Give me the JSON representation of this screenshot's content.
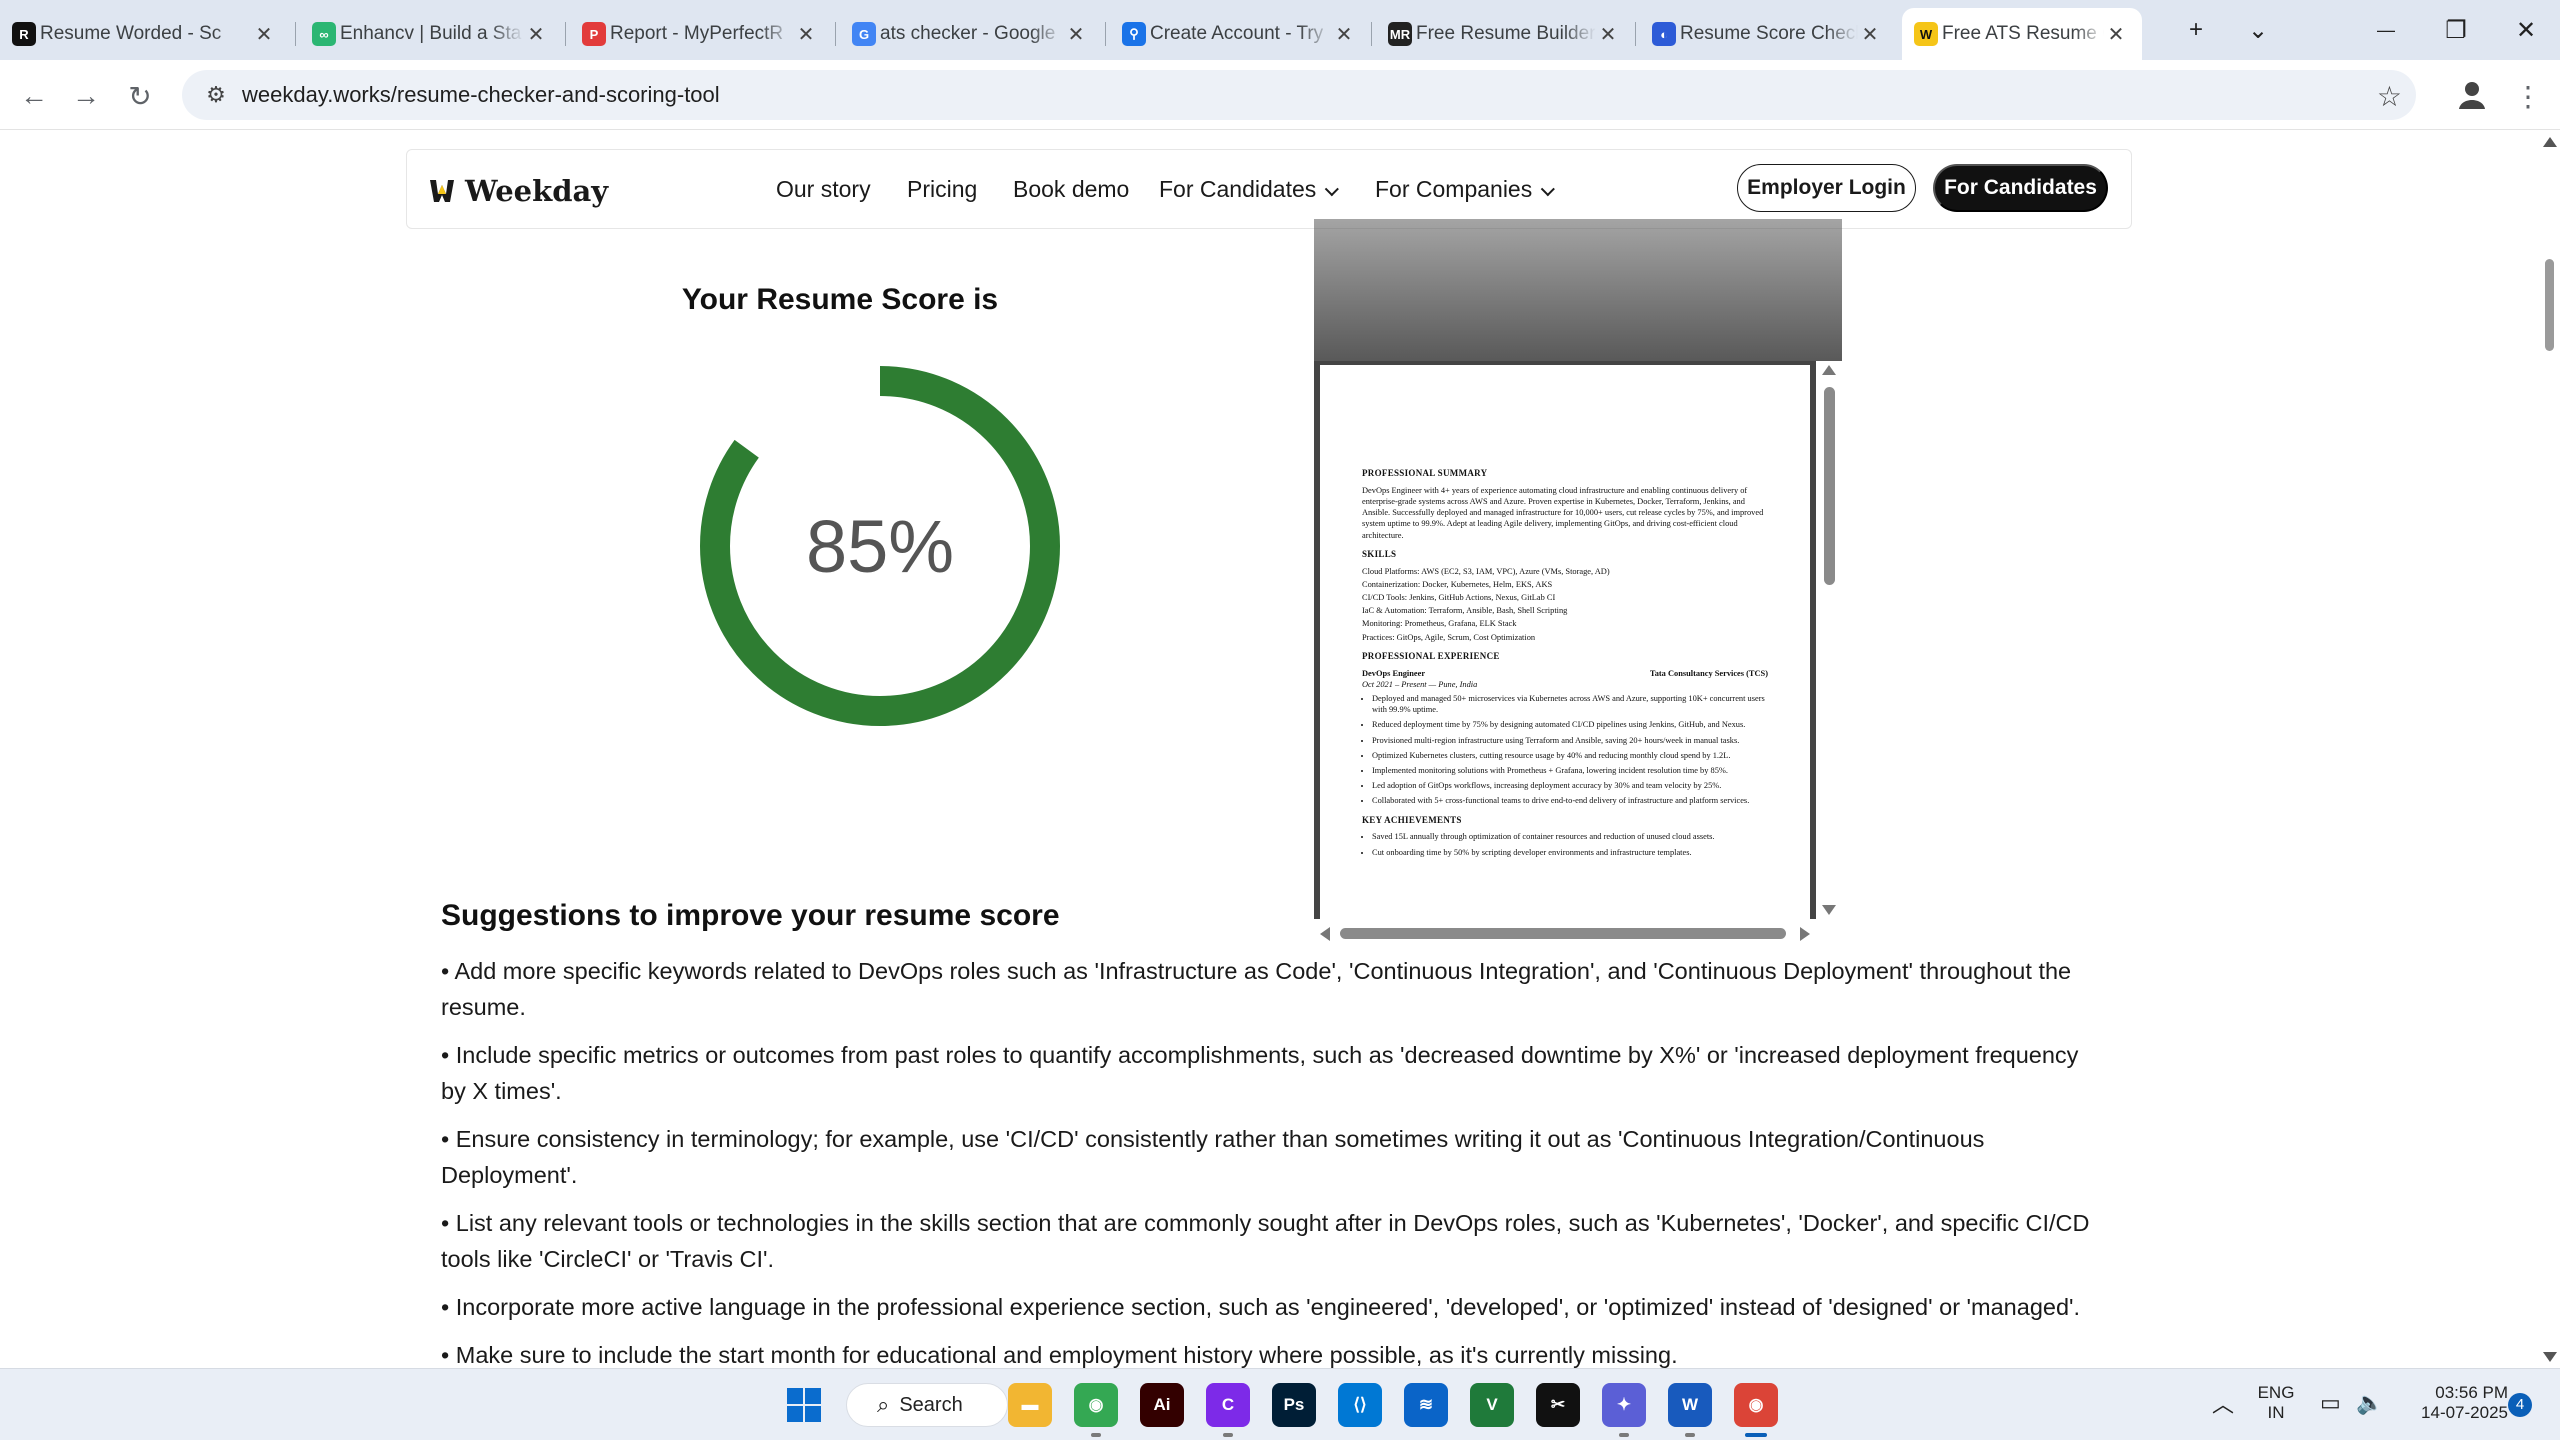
{
  "browser": {
    "tabs": [
      {
        "title": "Resume Worded - Sc",
        "favicon": "R",
        "color": "#111111"
      },
      {
        "title": "Enhancv | Build a Sta",
        "favicon": "∞",
        "color": "#2bb673"
      },
      {
        "title": "Report - MyPerfectR",
        "favicon": "P",
        "color": "#e23b3b"
      },
      {
        "title": "ats checker - Google",
        "favicon": "G",
        "color": "#4285f4"
      },
      {
        "title": "Create Account - Try",
        "favicon": "⚲",
        "color": "#1a73e8"
      },
      {
        "title": "Free Resume Builder",
        "favicon": "MR",
        "color": "#222222"
      },
      {
        "title": "Resume Score Check",
        "favicon": "◐",
        "color": "#2d5bd7"
      },
      {
        "title": "Free ATS Resume Ch",
        "favicon": "W",
        "color": "#f5c518"
      }
    ],
    "close_glyph": "✕",
    "new_tab_glyph": "+",
    "tab_search_glyph": "⌄",
    "url": "weekday.works/resume-checker-and-scoring-tool"
  },
  "nav": {
    "logo": "Weekday",
    "links": [
      "Our story",
      "Pricing",
      "Book demo",
      "For Candidates",
      "For Companies"
    ],
    "employer_login": "Employer Login",
    "for_candidates": "For Candidates"
  },
  "score": {
    "title": "Your Resume Score is",
    "value": "85%",
    "fraction": 0.85,
    "color": "#2e7d32"
  },
  "resume": {
    "summary_heading": "PROFESSIONAL SUMMARY",
    "summary_text": "DevOps Engineer with 4+ years of experience automating cloud infrastructure and enabling continuous delivery of enterprise-grade systems across AWS and Azure. Proven expertise in Kubernetes, Docker, Terraform, Jenkins, and Ansible. Successfully deployed and managed infrastructure for 10,000+ users, cut release cycles by 75%, and improved system uptime to 99.9%. Adept at leading Agile delivery, implementing GitOps, and driving cost-efficient cloud architecture.",
    "skills_heading": "SKILLS",
    "skills": [
      "Cloud Platforms: AWS (EC2, S3, IAM, VPC), Azure (VMs, Storage, AD)",
      "Containerization: Docker, Kubernetes, Helm, EKS, AKS",
      "CI/CD Tools: Jenkins, GitHub Actions, Nexus, GitLab CI",
      "IaC & Automation: Terraform, Ansible, Bash, Shell Scripting",
      "Monitoring: Prometheus, Grafana, ELK Stack",
      "Practices: GitOps, Agile, Scrum, Cost Optimization"
    ],
    "experience_heading": "PROFESSIONAL EXPERIENCE",
    "job_title": "DevOps Engineer",
    "company": "Tata Consultancy Services (TCS)",
    "job_dates": "Oct 2021 – Present — Pune, India",
    "bullets": [
      "Deployed and managed 50+ microservices via Kubernetes across AWS and Azure, supporting 10K+ concurrent users with 99.9% uptime.",
      "Reduced deployment time by 75% by designing automated CI/CD pipelines using Jenkins, GitHub, and Nexus.",
      "Provisioned multi-region infrastructure using Terraform and Ansible, saving 20+ hours/week in manual tasks.",
      "Optimized Kubernetes clusters, cutting resource usage by 40% and reducing monthly cloud spend by 1.2L.",
      "Implemented monitoring solutions with Prometheus + Grafana, lowering incident resolution time by 85%.",
      "Led adoption of GitOps workflows, increasing deployment accuracy by 30% and team velocity by 25%.",
      "Collaborated with 5+ cross-functional teams to drive end-to-end delivery of infrastructure and platform services."
    ],
    "achievements_heading": "KEY ACHIEVEMENTS",
    "achievements": [
      "Saved 15L annually through optimization of container resources and reduction of unused cloud assets.",
      "Cut onboarding time by 50% by scripting developer environments and infrastructure templates."
    ]
  },
  "suggestions": {
    "title": "Suggestions to improve your resume score",
    "items": [
      "• Add more specific keywords related to DevOps roles such as 'Infrastructure as Code', 'Continuous Integration', and 'Continuous Deployment' throughout the resume.",
      "• Include specific metrics or outcomes from past roles to quantify accomplishments, such as 'decreased downtime by X%' or 'increased deployment frequency by X times'.",
      "• Ensure consistency in terminology; for example, use 'CI/CD' consistently rather than sometimes writing it out as 'Continuous Integration/Continuous Deployment'.",
      "• List any relevant tools or technologies in the skills section that are commonly sought after in DevOps roles, such as 'Kubernetes', 'Docker', and specific CI/CD tools like 'CircleCI' or 'Travis CI'.",
      "• Incorporate more active language in the professional experience section, such as 'engineered', 'developed', or 'optimized' instead of 'designed' or 'managed'.",
      "• Make sure to include the start month for educational and employment history where possible, as it's currently missing."
    ]
  },
  "taskbar": {
    "search_label": "Search",
    "apps": [
      {
        "name": "file-explorer",
        "glyph": "▬",
        "color": "#f2b632"
      },
      {
        "name": "chrome",
        "glyph": "◉",
        "color": "#34a853"
      },
      {
        "name": "illustrator",
        "glyph": "Ai",
        "color": "#330000"
      },
      {
        "name": "canva",
        "glyph": "C",
        "color": "#7d2ae8"
      },
      {
        "name": "photoshop",
        "glyph": "Ps",
        "color": "#001e36"
      },
      {
        "name": "vscode",
        "glyph": "⟨⟩",
        "color": "#0078d4"
      },
      {
        "name": "azure-data-studio",
        "glyph": "≋",
        "color": "#0a64c8"
      },
      {
        "name": "vim",
        "glyph": "V",
        "color": "#1f7a3a"
      },
      {
        "name": "capcut",
        "glyph": "✂",
        "color": "#111111"
      },
      {
        "name": "copilot",
        "glyph": "✦",
        "color": "#5b5fd6"
      },
      {
        "name": "word",
        "glyph": "W",
        "color": "#185abd"
      },
      {
        "name": "chrome-active",
        "glyph": "◉",
        "color": "#db4437"
      }
    ],
    "language": "ENG",
    "region": "IN",
    "time": "03:56 PM",
    "date": "14-07-2025",
    "notification_count": "4"
  }
}
